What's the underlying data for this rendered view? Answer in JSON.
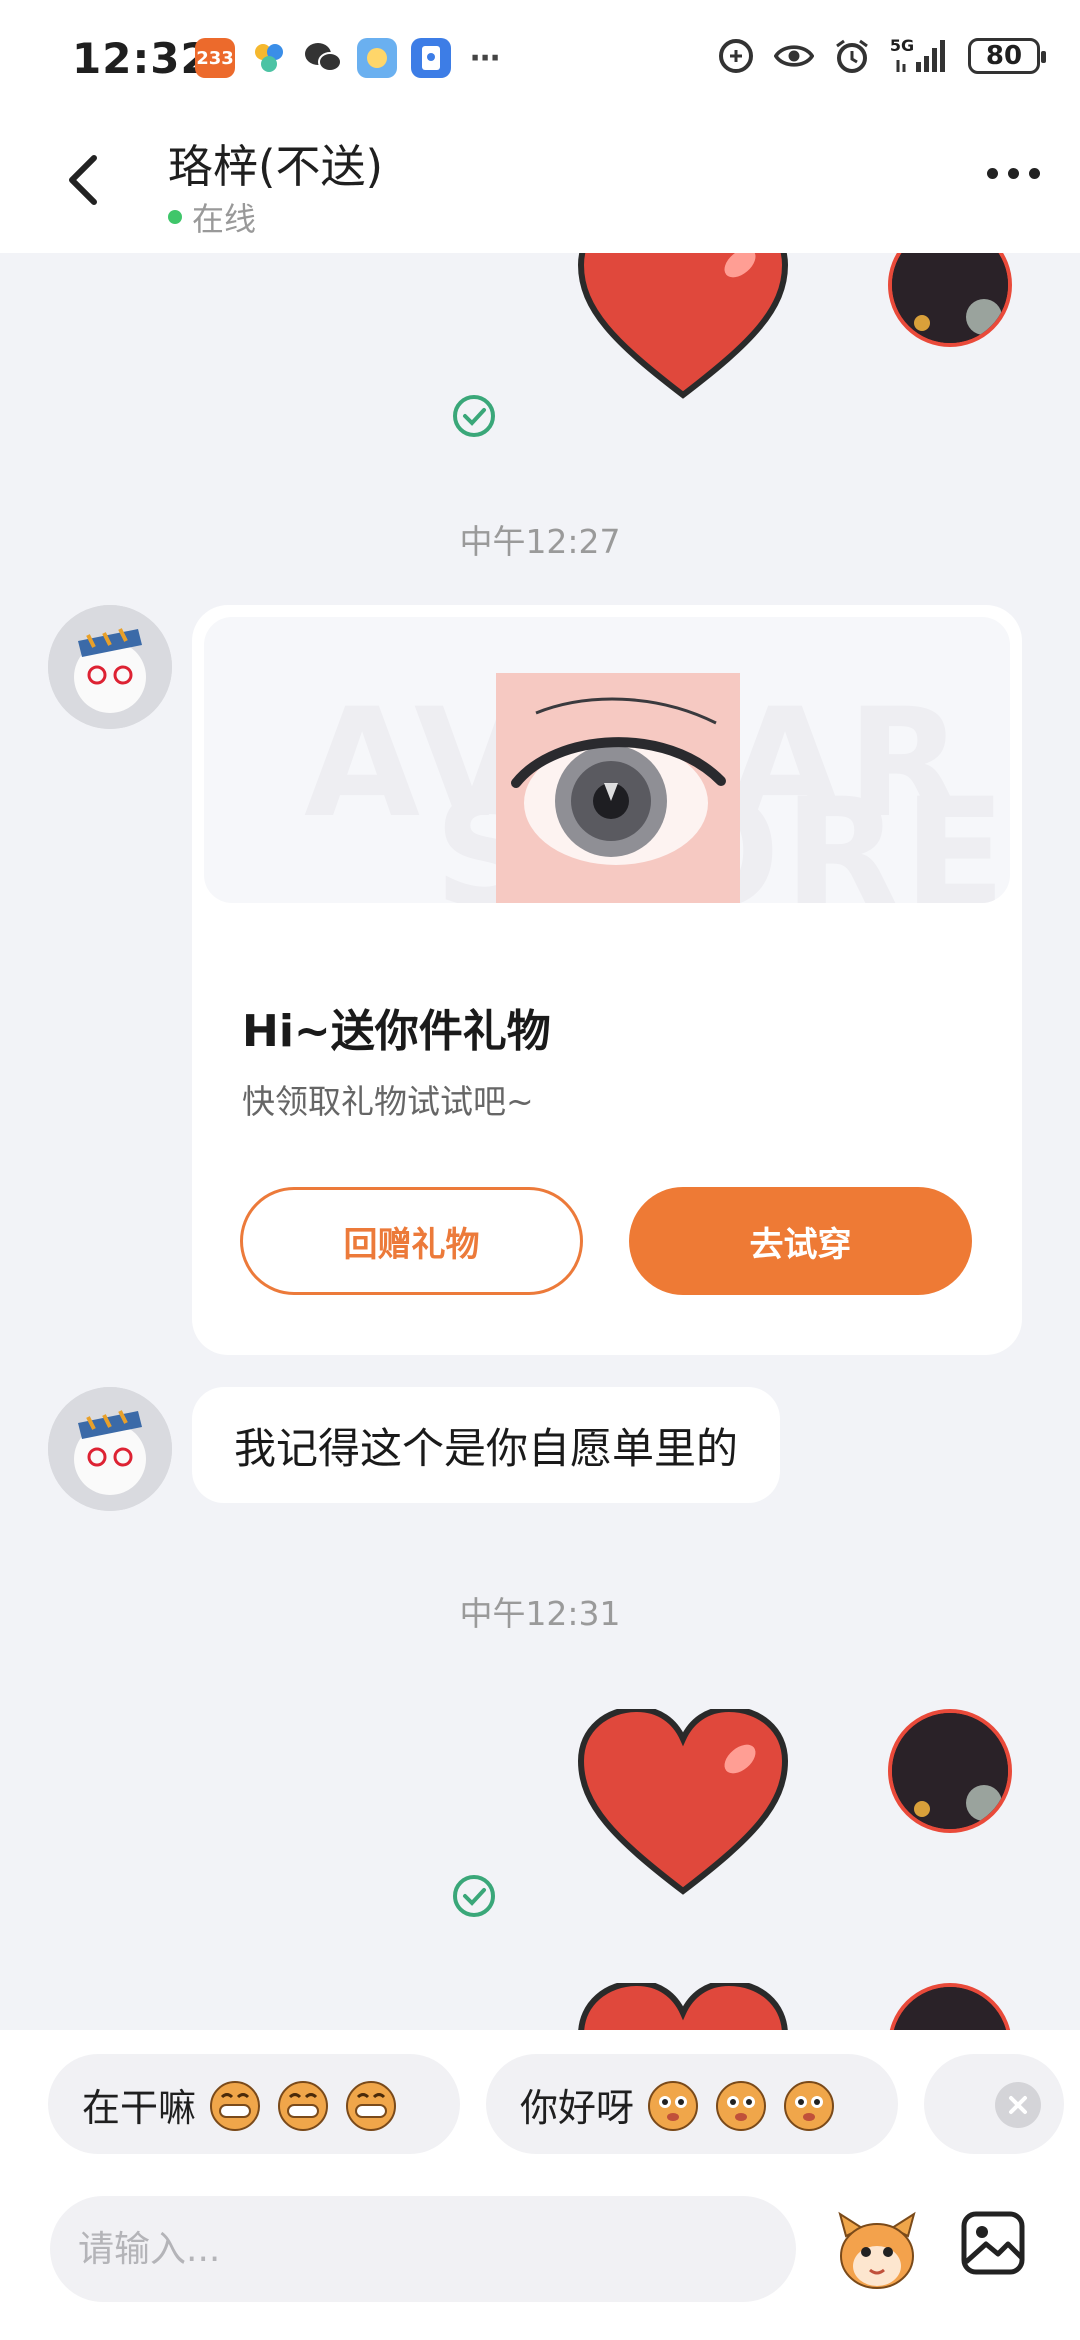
{
  "status_bar": {
    "time": "12:32",
    "app_badge": "233",
    "network": "5G",
    "battery": "80"
  },
  "header": {
    "title": "珞梓(不送)",
    "status": "在线"
  },
  "messages": {
    "timestamp_1": "中午12:27",
    "gift_card": {
      "title": "Hi~送你件礼物",
      "subtitle": "快领取礼物试试吧~",
      "return_gift_label": "回赠礼物",
      "try_on_label": "去试穿"
    },
    "text_message": "我记得这个是你自愿单里的",
    "timestamp_2": "中午12:31"
  },
  "quick_replies": [
    {
      "label": "在干嘛"
    },
    {
      "label": "你好呀"
    }
  ],
  "composer": {
    "placeholder": "请输入..."
  },
  "colors": {
    "accent": "#ee7a35",
    "online": "#3fc66a",
    "check": "#3aa779"
  }
}
